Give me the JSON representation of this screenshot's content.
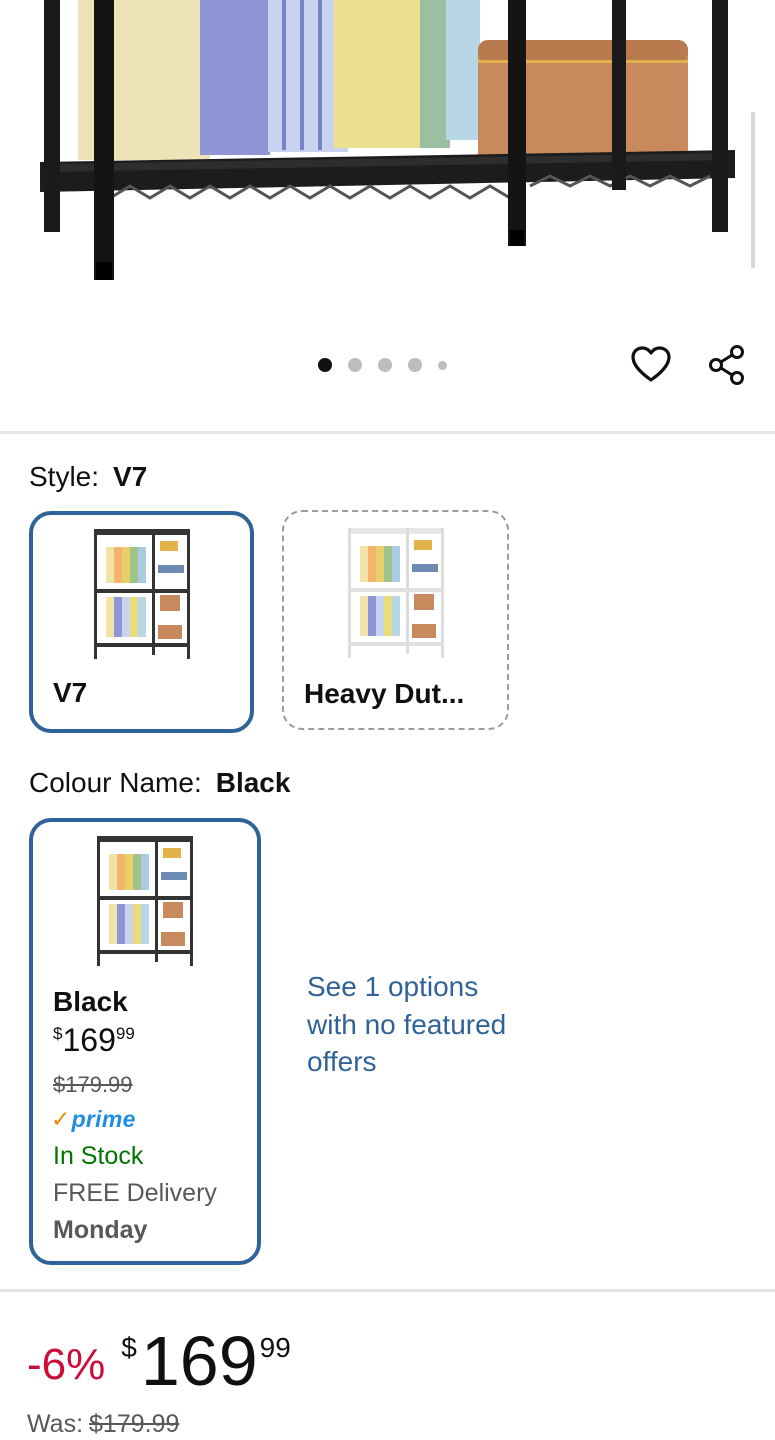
{
  "gallery": {
    "image_count": 5,
    "active_index": 0
  },
  "actions": {
    "wishlist_icon": "heart-outline-icon",
    "share_icon": "share-icon"
  },
  "style": {
    "label": "Style:",
    "selected_value": "V7",
    "options": [
      {
        "label": "V7",
        "frame_color": "#333333",
        "selected": true
      },
      {
        "label": "Heavy Dut...",
        "frame_color": "#f2f2f2",
        "selected": false
      }
    ]
  },
  "colour": {
    "label": "Colour Name:",
    "selected_value": "Black",
    "card": {
      "name": "Black",
      "currency": "$",
      "price_whole": "169",
      "price_fraction": "99",
      "was_price": "$179.99",
      "prime_label": "prime",
      "stock": "In Stock",
      "delivery": "FREE Delivery",
      "delivery_day": "Monday"
    },
    "see_options": "See 1 options with no featured offers"
  },
  "price": {
    "discount": "-6%",
    "currency": "$",
    "whole": "169",
    "fraction": "99",
    "was_label": "Was:",
    "was_value": "$179.99"
  },
  "colors": {
    "accent_link": "#2f6397",
    "selected_border": "#2f6397",
    "discount_red": "#cc0c39",
    "in_stock_green": "#007600",
    "prime_blue": "#1f8ee0"
  }
}
